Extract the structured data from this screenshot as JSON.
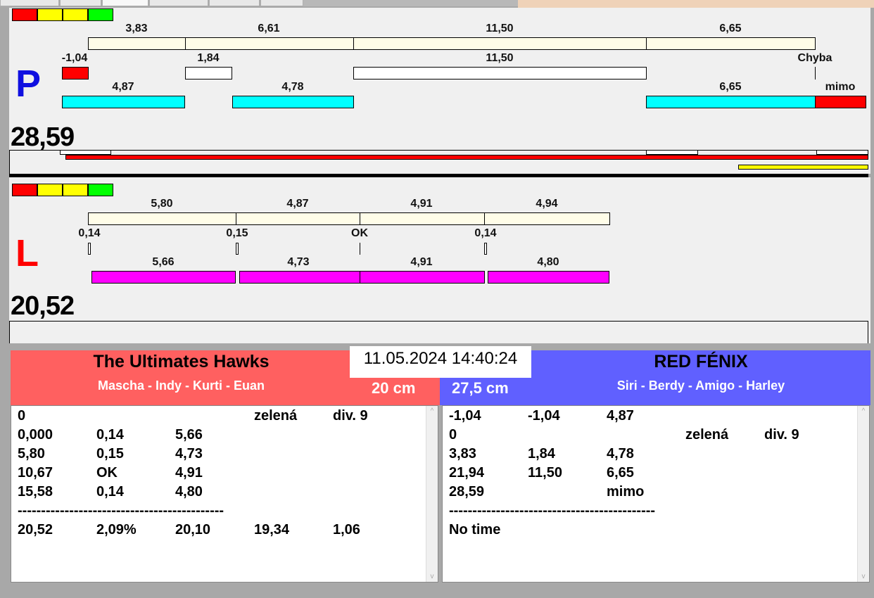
{
  "colors": {
    "team_left": "#ff6060",
    "team_right": "#6060ff",
    "cream": "#fffde8",
    "cyan": "#00ffff",
    "magenta": "#ff00ff"
  },
  "top": {
    "letter": "P",
    "total": "28,59",
    "row1": [
      "3,83",
      "6,61",
      "11,50",
      "6,65"
    ],
    "row2": [
      "-1,04",
      "1,84",
      "11,50",
      "Chyba"
    ],
    "row3": [
      "4,87",
      "4,78",
      "6,65",
      "mimo"
    ]
  },
  "bottom": {
    "letter": "L",
    "total": "20,52",
    "row1": [
      "5,80",
      "4,87",
      "4,91",
      "4,94"
    ],
    "row2": [
      "0,14",
      "0,15",
      "OK",
      "0,14"
    ],
    "row3": [
      "5,66",
      "4,73",
      "4,91",
      "4,80"
    ]
  },
  "datetime": "11.05.2024 14:40:24",
  "left_team": {
    "name": "The Ultimates Hawks",
    "members": "Mascha - Indy - Kurti - Euan",
    "height": "20 cm",
    "rows": [
      [
        "0",
        "",
        "",
        "zelená",
        "div. 9"
      ],
      [
        "0,000",
        "0,14",
        "5,66",
        "",
        ""
      ],
      [
        "5,80",
        "0,15",
        "4,73",
        "",
        ""
      ],
      [
        "10,67",
        "OK",
        "4,91",
        "",
        ""
      ],
      [
        "15,58",
        "0,14",
        "4,80",
        "",
        ""
      ],
      [
        "--------------------------------------------",
        "",
        "",
        "",
        ""
      ],
      [
        "20,52",
        "2,09%",
        "20,10",
        "19,34",
        "1,06"
      ]
    ]
  },
  "right_team": {
    "name": "RED FÉNIX",
    "members": "Siri - Berdy - Amigo - Harley",
    "height": "27,5 cm",
    "rows": [
      [
        "-1,04",
        "-1,04",
        "4,87",
        "",
        ""
      ],
      [
        "0",
        "",
        "",
        "zelená",
        "div. 9"
      ],
      [
        "3,83",
        "1,84",
        "4,78",
        "",
        ""
      ],
      [
        "21,94",
        "11,50",
        "6,65",
        "",
        ""
      ],
      [
        "28,59",
        "",
        "mimo",
        "",
        ""
      ],
      [
        "--------------------------------------------",
        "",
        "",
        "",
        ""
      ],
      [
        "No time",
        "",
        "",
        "",
        ""
      ]
    ]
  }
}
